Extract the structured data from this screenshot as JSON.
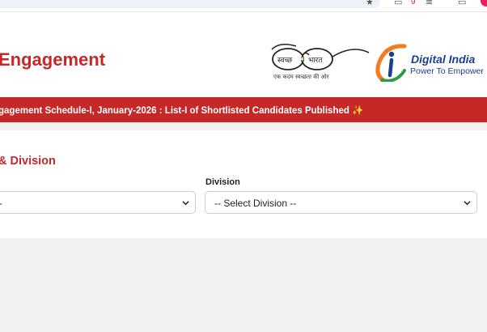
{
  "browser": {
    "link_text": "g",
    "icons": [
      "star-icon",
      "extension-icon",
      "reading-list-icon",
      "download-icon",
      "profile-avatar"
    ]
  },
  "header": {
    "title": "Engagement",
    "swachh_logo": {
      "left_text": "स्वच्छ",
      "right_text": "भारत",
      "tagline": "एक कदम स्वच्छता की ओर"
    },
    "digital_india": {
      "name": "Digital India",
      "tagline": "Power To Empower"
    }
  },
  "banner": {
    "text": "gagement Schedule-I, January-2026 : List-I of Shortlisted Candidates Published",
    "icon": "✨"
  },
  "form": {
    "section_title": "& Division",
    "division_label": "Division",
    "left_select_value": "-",
    "division_select_value": "-- Select Division --"
  },
  "colors": {
    "brand_red": "#c62828",
    "di_blue": "#1a3f8f",
    "di_orange": "#f47b20",
    "di_green": "#2e9b48",
    "page_bg": "#f3f2f1"
  }
}
